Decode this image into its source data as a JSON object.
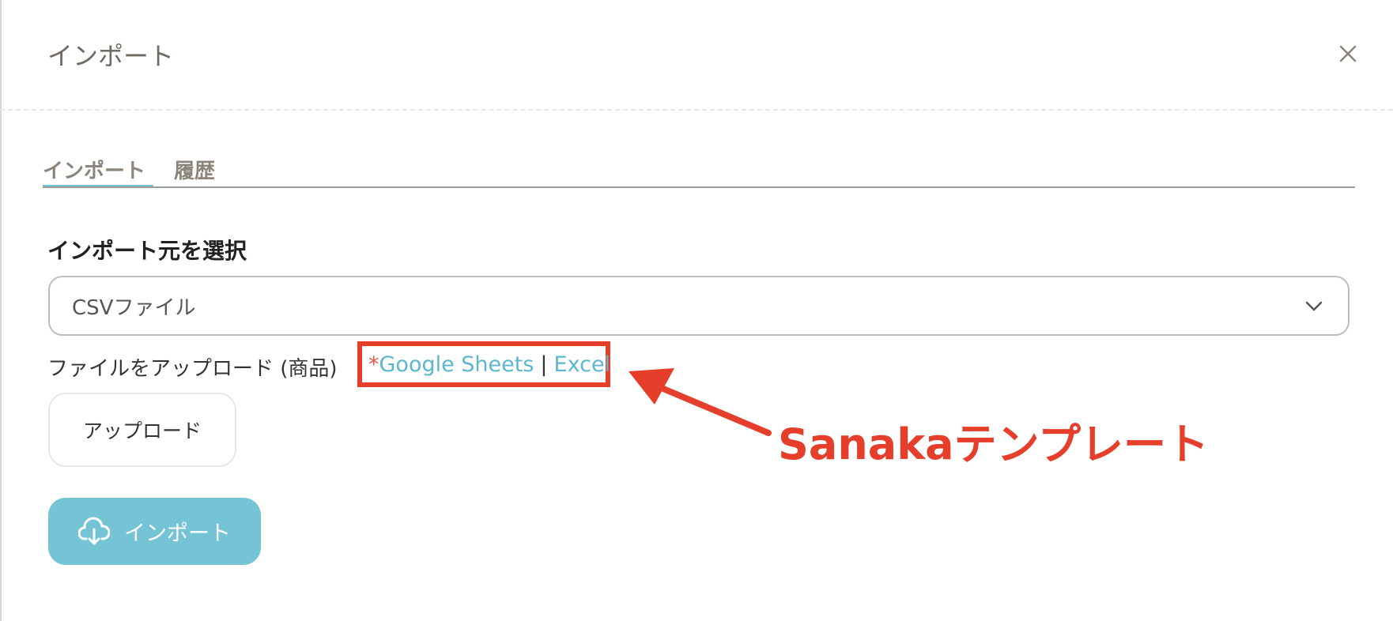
{
  "modal": {
    "title": "インポート",
    "close_icon": "close-icon"
  },
  "tabs": [
    {
      "label": "インポート",
      "active": true
    },
    {
      "label": "履歴",
      "active": false
    }
  ],
  "form": {
    "source_label": "インポート元を選択",
    "source_value": "CSVファイル",
    "upload_label": "ファイルをアップロード (商品)",
    "template_asterisk": "*",
    "template_link_1": "Google Sheets",
    "template_separator": "|",
    "template_link_2": "Excel",
    "upload_button": "アップロード",
    "import_button": "インポート"
  },
  "annotation": {
    "text": "Sanakaテンプレート"
  },
  "colors": {
    "accent": "#74c4d6",
    "link": "#5cb7cc",
    "annotation": "#e53e2b"
  }
}
